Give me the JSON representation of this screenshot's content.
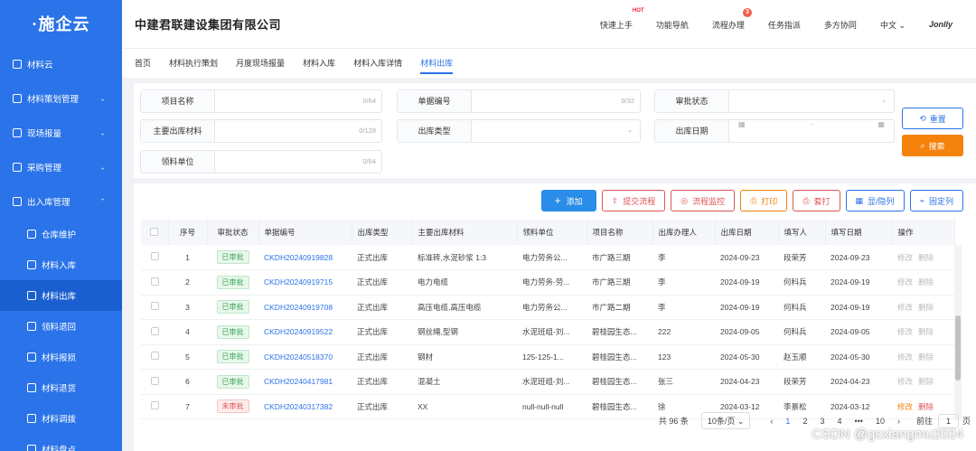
{
  "app": {
    "logo": "·施企云"
  },
  "sidebar": {
    "items": [
      {
        "label": "材料云",
        "level": 0,
        "chevron": ""
      },
      {
        "label": "材料策划管理",
        "level": 0,
        "chevron": "⌄"
      },
      {
        "label": "现场报量",
        "level": 0,
        "chevron": "⌄"
      },
      {
        "label": "采购管理",
        "level": 0,
        "chevron": "⌄"
      },
      {
        "label": "出入库管理",
        "level": 0,
        "chevron": "⌃"
      },
      {
        "label": "仓库维护",
        "level": 1,
        "chevron": ""
      },
      {
        "label": "材料入库",
        "level": 1,
        "chevron": ""
      },
      {
        "label": "材料出库",
        "level": 1,
        "chevron": "",
        "active": true
      },
      {
        "label": "领料退回",
        "level": 1,
        "chevron": ""
      },
      {
        "label": "材料报损",
        "level": 1,
        "chevron": ""
      },
      {
        "label": "材料退货",
        "level": 1,
        "chevron": ""
      },
      {
        "label": "材料调拨",
        "level": 1,
        "chevron": ""
      },
      {
        "label": "材料盘点",
        "level": 1,
        "chevron": ""
      }
    ]
  },
  "header": {
    "company": "中建君联建设集团有限公司",
    "menu": [
      "快速上手",
      "功能导航",
      "流程办理",
      "任务指派",
      "多方协同",
      "中文 ⌄"
    ],
    "hot": "HOT",
    "badge": "3",
    "brand": "Jonlly"
  },
  "tabs": [
    "首页",
    "材料执行策划",
    "月度现场报量",
    "材料入库",
    "材料入库详情",
    "材料出库"
  ],
  "filter": {
    "project": {
      "label": "项目名称",
      "count": "0/64"
    },
    "doc_no": {
      "label": "单据编号",
      "count": "0/32"
    },
    "approval": {
      "label": "审批状态"
    },
    "material": {
      "label": "主要出库材料",
      "count": "0/128"
    },
    "out_type": {
      "label": "出库类型"
    },
    "out_date": {
      "label": "出库日期",
      "sep": "-"
    },
    "unit": {
      "label": "领料单位",
      "count": "0/64"
    },
    "reset": "重置",
    "search": "搜索"
  },
  "toolbar": {
    "add": "添加",
    "submit": "提交流程",
    "monitor": "流程监控",
    "print": "打印",
    "batch_print": "套打",
    "toggle_cols": "显/隐列",
    "fix_cols": "固定列"
  },
  "table": {
    "headers": [
      "",
      "序号",
      "审批状态",
      "单据编号",
      "出库类型",
      "主要出库材料",
      "领料单位",
      "项目名称",
      "出库办理人",
      "出库日期",
      "填写人",
      "填写日期",
      "操作"
    ],
    "rows": [
      {
        "no": "1",
        "status": "已审批",
        "ok": true,
        "code": "CKDH20240919828",
        "type": "正式出库",
        "material": "标准砖,水泥砂浆 1:3",
        "unit": "电力劳务公...",
        "project": "市广路三期",
        "handler": "李",
        "date": "2024-09-23",
        "writer": "段荣芳",
        "wdate": "2024-09-23"
      },
      {
        "no": "2",
        "status": "已审批",
        "ok": true,
        "code": "CKDH20240919715",
        "type": "正式出库",
        "material": "电力电缆",
        "unit": "电力劳务-劳...",
        "project": "市广路三期",
        "handler": "李",
        "date": "2024-09-19",
        "writer": "何科兵",
        "wdate": "2024-09-19"
      },
      {
        "no": "3",
        "status": "已审批",
        "ok": true,
        "code": "CKDH20240919708",
        "type": "正式出库",
        "material": "高压电缆,高压电缆",
        "unit": "电力劳务公...",
        "project": "市广路二期",
        "handler": "李",
        "date": "2024-09-19",
        "writer": "何科兵",
        "wdate": "2024-09-19"
      },
      {
        "no": "4",
        "status": "已审批",
        "ok": true,
        "code": "CKDH20240919522",
        "type": "正式出库",
        "material": "钢丝绳,型钢",
        "unit": "水泥班组-刘...",
        "project": "碧桂园生态...",
        "handler": "222",
        "date": "2024-09-05",
        "writer": "何科兵",
        "wdate": "2024-09-05"
      },
      {
        "no": "5",
        "status": "已审批",
        "ok": true,
        "code": "CKDH20240518370",
        "type": "正式出库",
        "material": "钢材",
        "unit": "125-125-1...",
        "project": "碧桂园生态...",
        "handler": "123",
        "date": "2024-05-30",
        "writer": "赵玉顺",
        "wdate": "2024-05-30"
      },
      {
        "no": "6",
        "status": "已审批",
        "ok": true,
        "code": "CKDH20240417981",
        "type": "正式出库",
        "material": "混凝土",
        "unit": "水泥班组-刘...",
        "project": "碧桂园生态...",
        "handler": "张三",
        "date": "2024-04-23",
        "writer": "段荣芳",
        "wdate": "2024-04-23"
      },
      {
        "no": "7",
        "status": "未审批",
        "ok": false,
        "code": "CKDH20240317382",
        "type": "正式出库",
        "material": "XX",
        "unit": "null-null-null",
        "project": "碧桂园生态...",
        "handler": "徐",
        "date": "2024-03-12",
        "writer": "李景松",
        "wdate": "2024-03-12"
      }
    ],
    "ops": {
      "edit": "修改",
      "delete": "删除"
    }
  },
  "pager": {
    "total": "共 96 条",
    "size": "10条/页 ⌄",
    "prev": "‹",
    "pages": [
      "1",
      "2",
      "3",
      "4",
      "•••",
      "10"
    ],
    "current": "1",
    "next": "›",
    "goto": "前往",
    "goto_val": "1",
    "page_unit": "页"
  },
  "watermark": "CSDN @gcxiangmu2024"
}
